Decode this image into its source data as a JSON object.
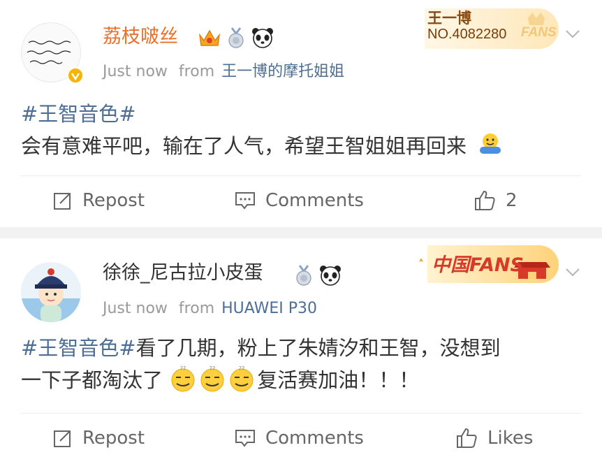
{
  "posts": [
    {
      "username": "荔枝啵丝",
      "time": "Just now",
      "from_label": "from",
      "source": "王一博的摩托姐姐",
      "hashtag": "#王智音色#",
      "line1": "",
      "line2": "会有意难平吧，输在了人气，希望王智姐姐再回来",
      "fans_badge": {
        "name": "王一博",
        "number": "NO.4082280",
        "label": "FANS"
      },
      "actions": {
        "repost": "Repost",
        "comments": "Comments",
        "likes": "2"
      }
    },
    {
      "username": "徐徐_尼古拉小皮蛋",
      "time": "Just now",
      "from_label": "from",
      "source": "HUAWEI P30",
      "hashtag": "#王智音色#",
      "line1": "看了几期，粉上了朱婧汐和王智，没想到",
      "line2a": "一下子都淘汰了",
      "line2b": "复活赛加油！！！",
      "fans_badge": {
        "label": "中国FANS"
      },
      "actions": {
        "repost": "Repost",
        "comments": "Comments",
        "likes": "Likes"
      }
    }
  ],
  "colors": {
    "accent_link": "#4d6e95",
    "vip_name": "#e8702a",
    "meta": "#9a9a9a",
    "divider": "#ececec",
    "section_bg": "#f2f2f2"
  }
}
